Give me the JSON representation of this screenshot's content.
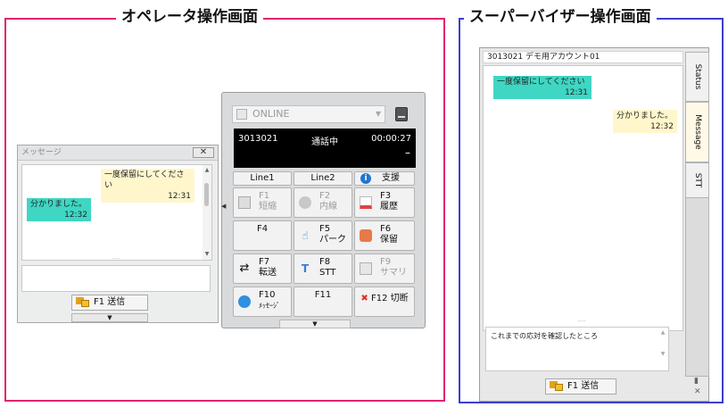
{
  "sections": {
    "operator_title": "オペレータ操作画面",
    "supervisor_title": "スーパーバイザー操作画面"
  },
  "colors": {
    "operator_frame": "#e0246e",
    "supervisor_frame": "#3a3fcf",
    "incoming_bubble": "#fff6cc",
    "outgoing_bubble": "#3fd6c3"
  },
  "operator_message_window": {
    "title": "メッセージ",
    "close": "✕",
    "messages": [
      {
        "text": "一度保留にしてください",
        "time": "12:31",
        "side": "right",
        "color": "yellow"
      },
      {
        "text": "分かりました。",
        "time": "12:32",
        "side": "left",
        "color": "teal"
      }
    ],
    "input_value": "",
    "send_label": "F1 送信"
  },
  "phone": {
    "status": "ONLINE",
    "display": {
      "number": "3013021",
      "state": "通話中",
      "timer": "00:00:27",
      "sub": "–"
    },
    "line_buttons": [
      "Line1",
      "Line2",
      "支援"
    ],
    "function_keys": [
      {
        "key": "F1",
        "label": "短縮",
        "icon": "speed-dial-icon",
        "enabled": false
      },
      {
        "key": "F2",
        "label": "内線",
        "icon": "extension-icon",
        "enabled": false
      },
      {
        "key": "F3",
        "label": "履歴",
        "icon": "history-icon",
        "enabled": true
      },
      {
        "key": "F4",
        "label": "",
        "icon": "",
        "enabled": true
      },
      {
        "key": "F5",
        "label": "パーク",
        "icon": "park-icon",
        "enabled": true
      },
      {
        "key": "F6",
        "label": "保留",
        "icon": "hold-icon",
        "enabled": true
      },
      {
        "key": "F7",
        "label": "転送",
        "icon": "transfer-icon",
        "enabled": true
      },
      {
        "key": "F8",
        "label": "STT",
        "icon": "stt-icon",
        "enabled": true
      },
      {
        "key": "F9",
        "label": "サマリ",
        "icon": "summary-icon",
        "enabled": false
      },
      {
        "key": "F10",
        "label": "ﾒｯｾｰｼﾞ",
        "icon": "message-icon",
        "enabled": true
      },
      {
        "key": "F11",
        "label": "",
        "icon": "",
        "enabled": true
      },
      {
        "key": "F12",
        "label": "切断",
        "icon": "disconnect-icon",
        "enabled": true
      }
    ]
  },
  "supervisor_window": {
    "title": "3013021 デモ用アカウント01",
    "messages": [
      {
        "text": "一度保留にしてください",
        "time": "12:31",
        "side": "left",
        "color": "teal"
      },
      {
        "text": "分かりました。",
        "time": "12:32",
        "side": "right",
        "color": "yellow"
      }
    ],
    "input_value": "これまでの応対を確認したところ",
    "send_label": "F1 送信",
    "tabs": [
      "Status",
      "Message",
      "STT"
    ],
    "active_tab": "Message"
  }
}
